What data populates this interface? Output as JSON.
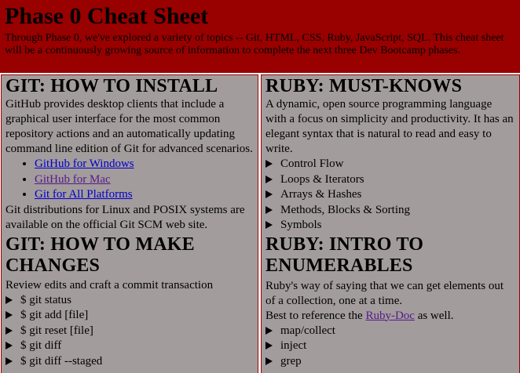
{
  "header": {
    "title": "Phase 0 Cheat Sheet",
    "intro": "Through Phase 0, we've explored a variety of topics -- Git, HTML, CSS, Ruby, JavaScript, SQL. This cheat sheet will be a continuously growing source of information to complete the next three Dev Bootcamp phases."
  },
  "git_install": {
    "heading": "GIT: HOW TO INSTALL",
    "description": "GitHub provides desktop clients that include a graphical user interface for the most common repository actions and an automatically updating command line edition of Git for advanced scenarios.",
    "links": [
      "GitHub for Windows",
      "GitHub for Mac",
      "Git for All Platforms"
    ],
    "footer": "Git distributions for Linux and POSIX systems are available on the official Git SCM web site."
  },
  "git_changes": {
    "heading": "GIT: HOW TO MAKE CHANGES",
    "description": "Review edits and craft a commit transaction",
    "items": [
      "$ git status",
      "$ git add [file]",
      "$ git reset [file]",
      "$ git diff",
      "$ git diff --staged"
    ]
  },
  "ruby_must": {
    "heading": "RUBY: MUST-KNOWS",
    "description": "A dynamic, open source programming language with a focus on simplicity and productivity. It has an elegant syntax that is natural to read and easy to write.",
    "items": [
      "Control Flow",
      "Loops & Iterators",
      "Arrays & Hashes",
      "Methods, Blocks & Sorting",
      "Symbols"
    ]
  },
  "ruby_enum": {
    "heading": "RUBY: INTRO TO ENUMERABLES",
    "description": "Ruby's way of saying that we can get elements out of a collection, one at a time.",
    "ref_prefix": "Best to reference the ",
    "ref_link": "Ruby-Doc",
    "ref_suffix": " as well.",
    "items": [
      "map/collect",
      "inject",
      "grep"
    ]
  },
  "colors": {
    "header_bg": "#990000",
    "panel_bg": "#a39c9c",
    "link": "#0000cc",
    "visited_link": "#551a8b"
  }
}
